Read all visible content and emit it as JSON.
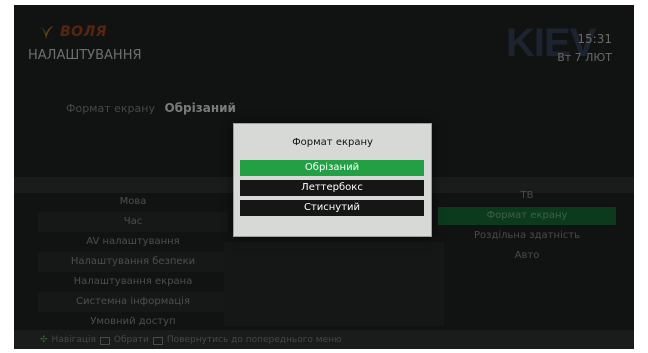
{
  "header": {
    "brand": "ВОЛЯ",
    "title": "НАЛАШТУВАННЯ",
    "channel_logo": "KIEV",
    "time": "15:31",
    "date": "Вт 7 ЛЮТ"
  },
  "breadcrumb": {
    "label": "Формат екрану",
    "value": "Обрізаний"
  },
  "left_menu": [
    {
      "label": "Мова"
    },
    {
      "label": "Час"
    },
    {
      "label": "AV налаштування"
    },
    {
      "label": "Налаштування безпеки"
    },
    {
      "label": "Налаштування екрана"
    },
    {
      "label": "Системна інформація"
    },
    {
      "label": "Умовний доступ"
    }
  ],
  "right_menu": [
    {
      "label": "ТВ"
    },
    {
      "label": "Формат екрану"
    },
    {
      "label": "Роздільна здатність"
    },
    {
      "label": "Авто"
    }
  ],
  "dialog": {
    "title": "Формат екрану",
    "options": [
      {
        "label": "Обрізаний",
        "selected": true
      },
      {
        "label": "Леттербокс",
        "selected": false
      },
      {
        "label": "Стиснутий",
        "selected": false
      }
    ]
  },
  "footer": {
    "navigate": "Навігація",
    "select": "Обрати",
    "back": "Повернутись до попереднього меню"
  },
  "colors": {
    "background": "#111212",
    "highlight": "#23a043",
    "dialog_bg": "#d7d9d7",
    "brand_logo": "#5a2510"
  },
  "icons": {
    "brand": "leaf-logo-icon",
    "navigate": "dpad-icon",
    "select": "ok-button-icon",
    "back": "back-button-icon"
  }
}
